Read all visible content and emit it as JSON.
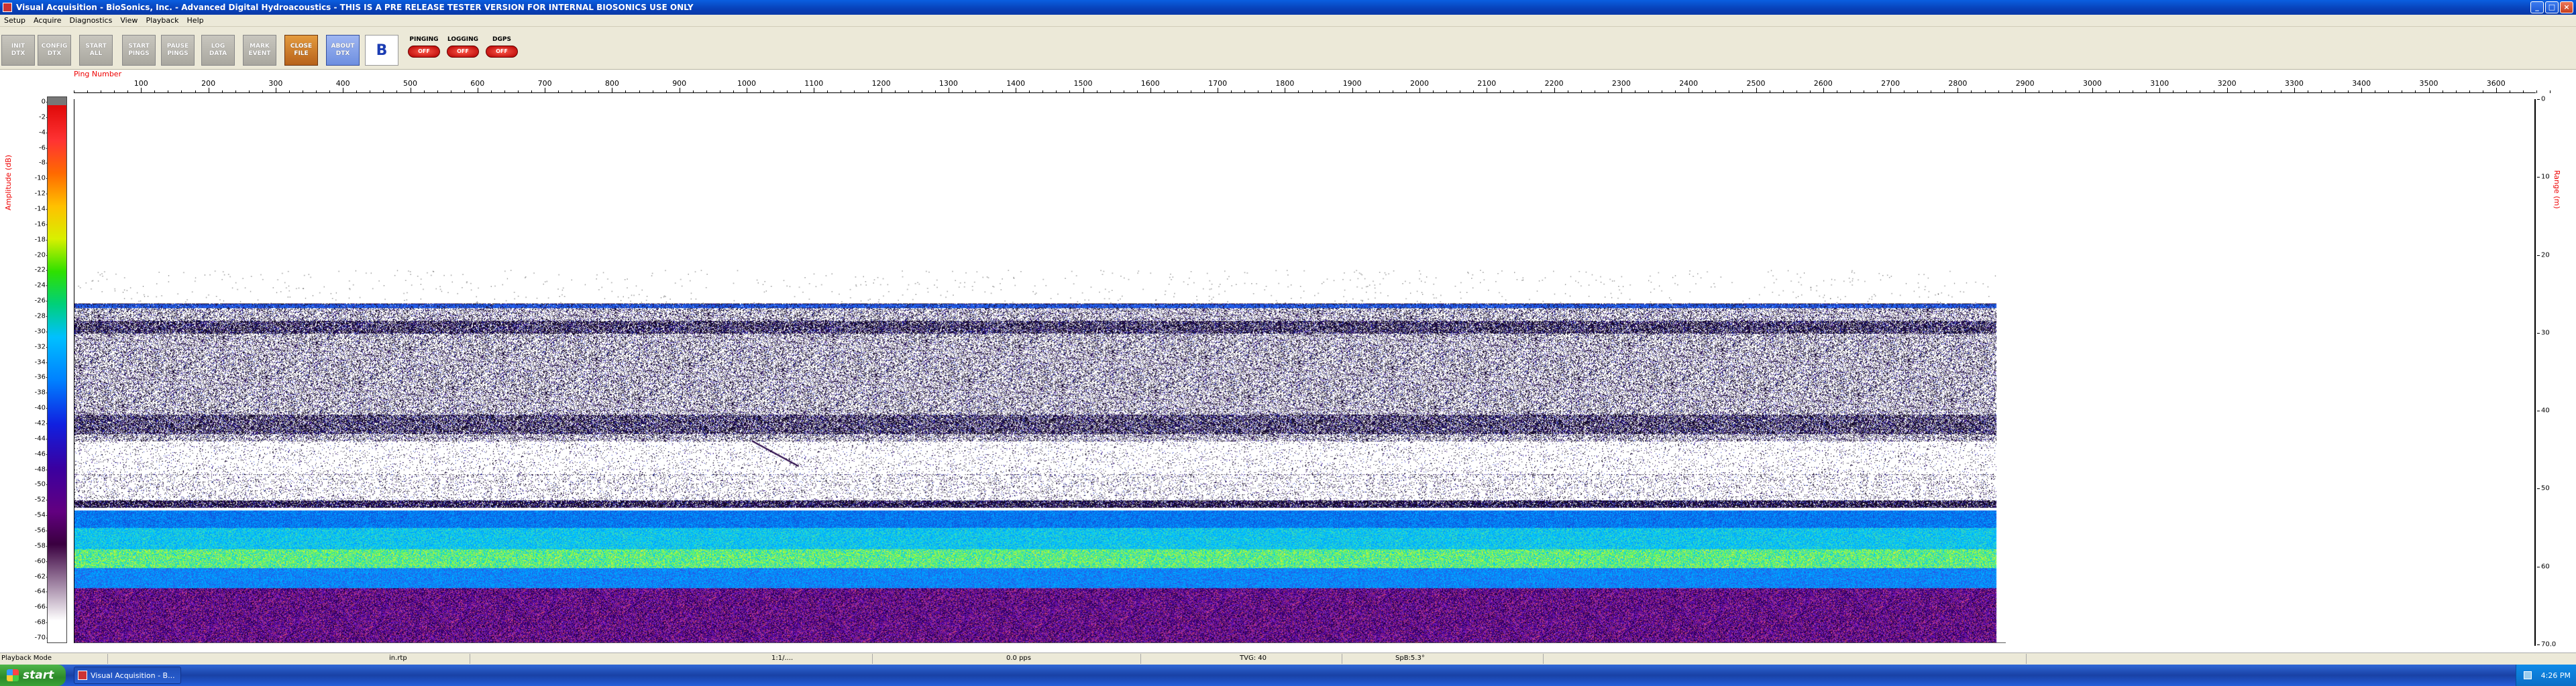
{
  "window": {
    "title": "Visual Acquisition  -  BioSonics, Inc.  -  Advanced Digital Hydroacoustics  -  THIS IS A PRE RELEASE TESTER VERSION FOR INTERNAL BIOSONICS USE ONLY",
    "minimize": "_",
    "maximize": "□",
    "close": "×"
  },
  "menu": [
    "Setup",
    "Acquire",
    "Diagnostics",
    "View",
    "Playback",
    "Help"
  ],
  "toolbar": {
    "buttons": [
      {
        "label": "INIT\nDTX",
        "style": "gray"
      },
      {
        "label": "CONFIG\nDTX",
        "style": "gray"
      },
      {
        "label": "START\nALL",
        "style": "gray"
      },
      {
        "label": "START\nPINGS",
        "style": "gray"
      },
      {
        "label": "PAUSE\nPINGS",
        "style": "gray"
      },
      {
        "label": "LOG\nDATA",
        "style": "gray"
      },
      {
        "label": "MARK\nEVENT",
        "style": "gray"
      },
      {
        "label": "CLOSE\nFILE",
        "style": "orange"
      },
      {
        "label": "ABOUT\nDTX",
        "style": "blue"
      }
    ],
    "logo": "B",
    "indicators": [
      {
        "label": "PINGING",
        "state": "OFF"
      },
      {
        "label": "LOGGING",
        "state": "OFF"
      },
      {
        "label": "DGPS",
        "state": "OFF"
      }
    ]
  },
  "plot": {
    "ping_axis_title": "Ping Number",
    "ping_ticks": [
      "100",
      "200",
      "300",
      "400",
      "500",
      "600",
      "700",
      "800",
      "900",
      "1000",
      "1100",
      "1200",
      "1300",
      "1400",
      "1500",
      "1600",
      "1700",
      "1800",
      "1900",
      "2000",
      "2100",
      "2200",
      "2300",
      "2400",
      "2500",
      "2600",
      "2700",
      "2800",
      "2900",
      "3000",
      "3100",
      "3200",
      "3300",
      "3400",
      "3500",
      "3600"
    ],
    "amplitude_title": "Amplitude (dB)",
    "amplitude_ticks": [
      "0",
      "-2",
      "-4",
      "-6",
      "-8",
      "-10",
      "-12",
      "-14",
      "-16",
      "-18",
      "-20",
      "-22",
      "-24",
      "-26",
      "-28",
      "-30",
      "-32",
      "-34",
      "-36",
      "-38",
      "-40",
      "-42",
      "-44",
      "-46",
      "-48",
      "-50",
      "-52",
      "-54",
      "-56",
      "-58",
      "-60",
      "-62",
      "-64",
      "-66",
      "-68",
      "-70"
    ],
    "range_title": "Range (m)",
    "range_ticks": [
      "0",
      "10",
      "20",
      "30",
      "40",
      "50",
      "60",
      "70.0"
    ],
    "colors": {
      "accent_red": "#e00000",
      "titlebar_blue": "#0a5fe0"
    }
  },
  "status": {
    "mode": "Playback Mode",
    "file": "in.rtp",
    "ratio": "1:1/....",
    "pps": "0.0 pps",
    "tvg": "TVG: 40",
    "spb": "SpB:5.3°"
  },
  "taskbar": {
    "start": "start",
    "task": "Visual Acquisition  -  B...",
    "clock": "4:26 PM"
  }
}
